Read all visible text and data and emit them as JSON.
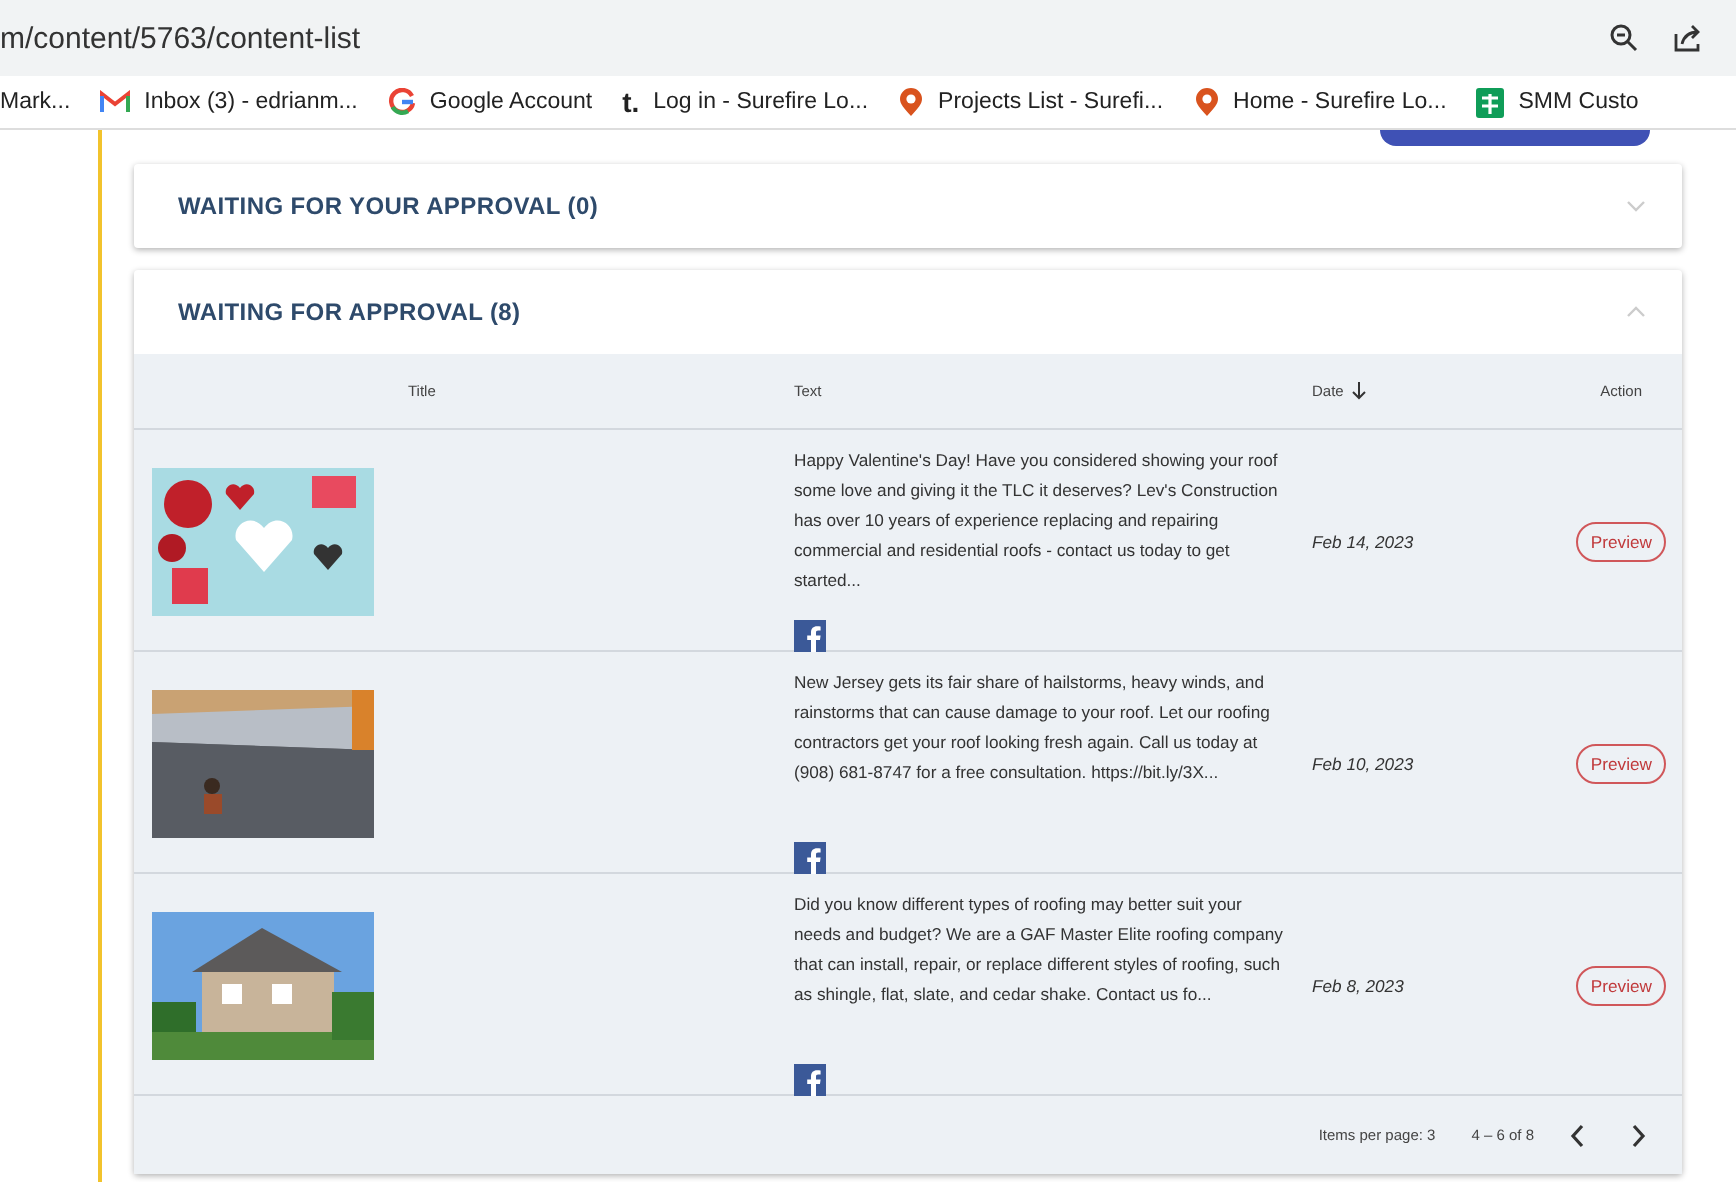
{
  "browser": {
    "url": "m/content/5763/content-list"
  },
  "bookmarks": [
    {
      "label": "Mark..."
    },
    {
      "label": "Inbox (3) - edrianm..."
    },
    {
      "label": "Google Account"
    },
    {
      "label": "Log in - Surefire Lo...",
      "icon_text": "t."
    },
    {
      "label": "Projects List - Surefi..."
    },
    {
      "label": "Home - Surefire Lo..."
    },
    {
      "label": "SMM Custo"
    }
  ],
  "panels": [
    {
      "title": "WAITING FOR YOUR APPROVAL (0)",
      "expanded": false
    },
    {
      "title": "WAITING FOR APPROVAL (8)",
      "expanded": true
    }
  ],
  "table": {
    "columns": [
      "Title",
      "Text",
      "Date",
      "Action"
    ],
    "rows": [
      {
        "text": "Happy Valentine's Day! Have you considered showing your roof some love and giving it the TLC it deserves? Lev's Construction has over 10 years of experience replacing and repairing commercial and residential roofs - contact us today to get started...",
        "date": "Feb 14, 2023",
        "action": "Preview"
      },
      {
        "text": "New Jersey gets its fair share of hailstorms, heavy winds, and rainstorms that can cause damage to your roof. Let our roofing contractors get your roof looking fresh again. Call us today at (908) 681-8747 for a free consultation. https://bit.ly/3X...",
        "date": "Feb 10, 2023",
        "action": "Preview"
      },
      {
        "text": "Did you know different types of roofing may better suit your needs and budget? We are a GAF Master Elite roofing company that can install, repair, or replace different styles of roofing, such as shingle, flat, slate, and cedar shake. Contact us fo...",
        "date": "Feb 8, 2023",
        "action": "Preview"
      }
    ]
  },
  "pagination": {
    "items_per_page": "Items per page: 3",
    "range": "4 – 6 of 8"
  }
}
